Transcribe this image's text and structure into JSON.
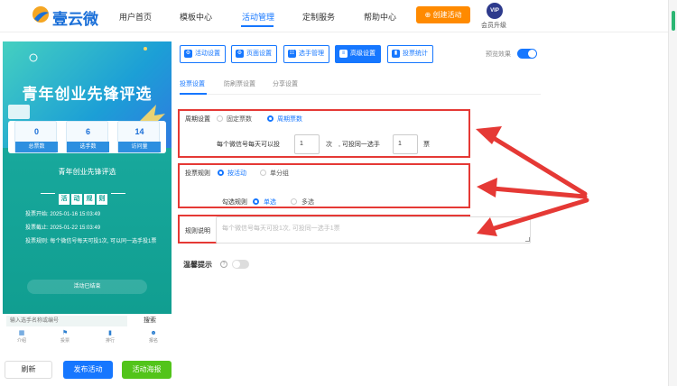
{
  "brand": {
    "name": "壹云微"
  },
  "nav": {
    "items": [
      "用户首页",
      "模板中心",
      "活动管理",
      "定制服务",
      "帮助中心"
    ],
    "create_button": "创建活动",
    "vip_badge": "VIP",
    "vip_label": "会员升级"
  },
  "preview": {
    "banner_title": "青年创业先锋评选",
    "stats": [
      {
        "value": "0",
        "label": "总票数"
      },
      {
        "value": "6",
        "label": "选手数"
      },
      {
        "value": "14",
        "label": "访问量"
      }
    ],
    "activity_title": "青年创业先锋评选",
    "rules_chars": [
      "活",
      "动",
      "规",
      "则"
    ],
    "info": {
      "start": "投票开始: 2025-01-16 15:03:49",
      "end": "投票截止: 2025-01-22 15:03:49",
      "rule": "投票规则: 每个微信号每天可投1次, 可以同一选手投1票"
    },
    "ended_label": "活动已结束",
    "search_placeholder": "输入选手名称或编号",
    "search_button": "搜索",
    "tabs": [
      "介绍",
      "投票",
      "排行",
      "报名"
    ]
  },
  "actions": {
    "refresh": "刷新",
    "publish": "发布活动",
    "poster": "活动海报"
  },
  "toolbar": {
    "buttons": [
      "活动设置",
      "页面设置",
      "选手管理",
      "高级设置",
      "投票统计"
    ],
    "active": "高级设置",
    "preview_label": "预览效果"
  },
  "subtabs": [
    "投票设置",
    "防刷票设置",
    "分享设置"
  ],
  "form": {
    "cycle": {
      "label": "周期设置",
      "options": [
        "固定票数",
        "周期票数"
      ],
      "selected": "周期票数",
      "sentence_prefix": "每个微信号每天可以投",
      "votes_value": "1",
      "times_unit": "次",
      "sentence_mid": ", 可投同一选手",
      "same_value": "1",
      "ticket_unit": "票"
    },
    "rule": {
      "label": "投票规则",
      "options": [
        "按活动",
        "单分组"
      ],
      "selected": "按活动",
      "check_label": "勾选规则",
      "check_options": [
        "单选",
        "多选"
      ],
      "check_selected": "单选"
    },
    "desc": {
      "label": "规则说明",
      "placeholder": "每个微信号每天可投1次, 可投同一选手1票"
    },
    "warning": {
      "label": "温馨提示",
      "enabled": false
    }
  }
}
